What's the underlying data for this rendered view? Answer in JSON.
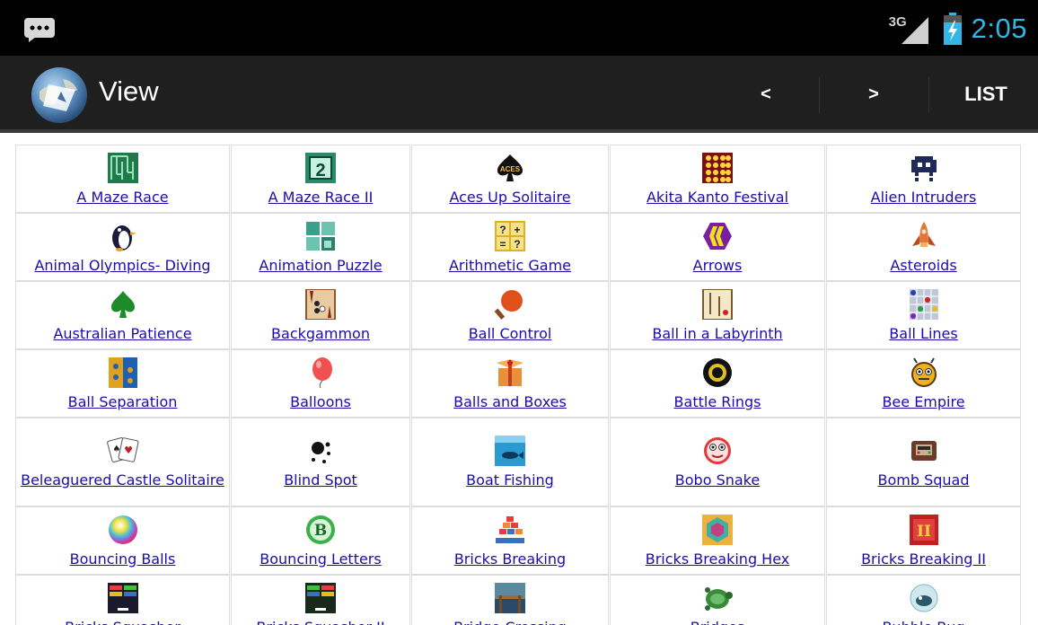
{
  "status_bar": {
    "network_label": "3G",
    "time": "2:05",
    "notification_icon": "chat-notification-icon",
    "battery_icon": "battery-charging-icon",
    "signal_icon": "signal-icon",
    "time_color": "#33b5e5"
  },
  "action_bar": {
    "title": "View",
    "logo_icon": "app-logo-globe-icon",
    "prev_label": "<",
    "next_label": ">",
    "list_label": "LIST",
    "background": "#1f1f1f"
  },
  "games": [
    {
      "label": "A Maze Race",
      "icon": "maze-icon"
    },
    {
      "label": "A Maze Race II",
      "icon": "maze-2-icon"
    },
    {
      "label": "Aces Up Solitaire",
      "icon": "spade-aces-icon"
    },
    {
      "label": "Akita Kanto Festival",
      "icon": "lantern-grid-icon"
    },
    {
      "label": "Alien Intruders",
      "icon": "space-invader-icon"
    },
    {
      "label": "Animal Olympics- Diving",
      "icon": "penguin-icon"
    },
    {
      "label": "Animation Puzzle",
      "icon": "puzzle-tiles-icon"
    },
    {
      "label": "Arithmetic Game",
      "icon": "arithmetic-grid-icon"
    },
    {
      "label": "Arrows",
      "icon": "arrows-icon"
    },
    {
      "label": "Asteroids",
      "icon": "rocket-icon"
    },
    {
      "label": "Australian Patience",
      "icon": "spade-icon"
    },
    {
      "label": "Backgammon",
      "icon": "backgammon-icon"
    },
    {
      "label": "Ball Control",
      "icon": "paddle-icon"
    },
    {
      "label": "Ball in a Labyrinth",
      "icon": "labyrinth-icon"
    },
    {
      "label": "Ball Lines",
      "icon": "ball-lines-icon"
    },
    {
      "label": "Ball Separation",
      "icon": "ball-separation-icon"
    },
    {
      "label": "Balloons",
      "icon": "balloon-icon"
    },
    {
      "label": "Balls and Boxes",
      "icon": "gift-box-icon"
    },
    {
      "label": "Battle Rings",
      "icon": "ring-icon"
    },
    {
      "label": "Bee Empire",
      "icon": "bee-icon"
    },
    {
      "label": "Beleaguered Castle Solitaire",
      "icon": "cards-icon"
    },
    {
      "label": "Blind Spot",
      "icon": "dots-icon"
    },
    {
      "label": "Boat Fishing",
      "icon": "fish-icon"
    },
    {
      "label": "Bobo Snake",
      "icon": "snake-face-icon"
    },
    {
      "label": "Bomb Squad",
      "icon": "bomb-device-icon"
    },
    {
      "label": "Bouncing Balls",
      "icon": "color-ball-icon"
    },
    {
      "label": "Bouncing Letters",
      "icon": "letter-b-icon"
    },
    {
      "label": "Bricks Breaking",
      "icon": "bricks-icon"
    },
    {
      "label": "Bricks Breaking Hex",
      "icon": "hex-bricks-icon"
    },
    {
      "label": "Bricks Breaking II",
      "icon": "bricks-2-icon"
    },
    {
      "label": "Bricks Squasher",
      "icon": "bricks-squasher-icon"
    },
    {
      "label": "Bricks Squasher II",
      "icon": "bricks-squasher-2-icon"
    },
    {
      "label": "Bridge Crossing",
      "icon": "bridge-icon"
    },
    {
      "label": "Bridges",
      "icon": "turtle-icon"
    },
    {
      "label": "Bubble Bug",
      "icon": "bubble-bug-icon"
    }
  ]
}
